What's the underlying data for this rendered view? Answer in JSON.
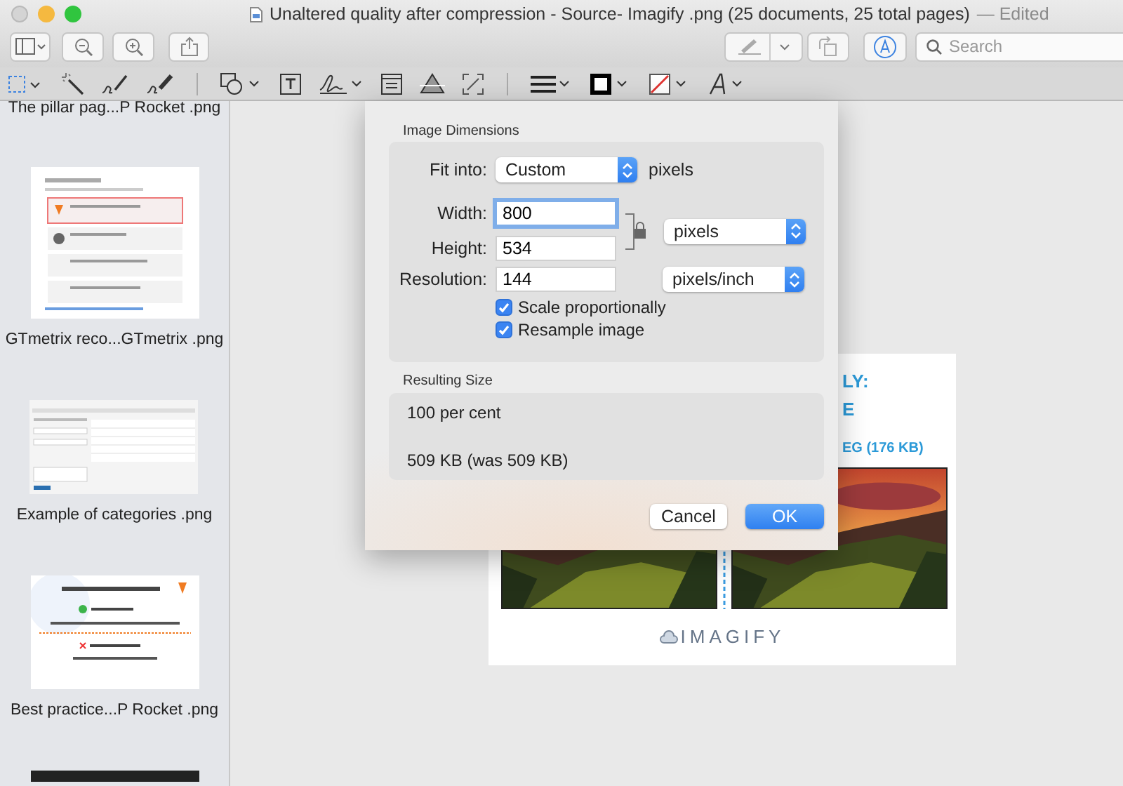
{
  "window": {
    "title": "Unaltered quality after compression - Source- Imagify .png (25 documents, 25 total pages)",
    "status": "— Edited"
  },
  "search": {
    "placeholder": "Search"
  },
  "sidebar": {
    "items": [
      {
        "kind": "label-only",
        "label": "The pillar pag...P Rocket .png"
      },
      {
        "kind": "list",
        "label": "GTmetrix reco...GTmetrix .png"
      },
      {
        "kind": "table",
        "label": "Example of categories  .png"
      },
      {
        "kind": "banner",
        "label": "Best practice...P Rocket .png"
      },
      {
        "kind": "dark"
      }
    ]
  },
  "document": {
    "heading_lines": [
      "LY:",
      "E"
    ],
    "caption": "EG (176 KB)",
    "logo": "IMAGIFY"
  },
  "dialog": {
    "dimensions_title": "Image Dimensions",
    "fit": {
      "label": "Fit into:",
      "value": "Custom",
      "unit": "pixels"
    },
    "width": {
      "label": "Width:",
      "value": "800",
      "focused": true
    },
    "height": {
      "label": "Height:",
      "value": "534",
      "focused": false
    },
    "size_unit": "pixels",
    "resolution": {
      "label": "Resolution:",
      "value": "144",
      "unit": "pixels/inch"
    },
    "options": [
      {
        "label": "Scale proportionally",
        "checked": true
      },
      {
        "label": "Resample image",
        "checked": true
      }
    ],
    "result_title": "Resulting Size",
    "result_percent": "100 per cent",
    "result_size": "509 KB (was 509 KB)",
    "buttons": [
      {
        "label": "Cancel",
        "default": false
      },
      {
        "label": "OK",
        "default": true
      }
    ]
  }
}
